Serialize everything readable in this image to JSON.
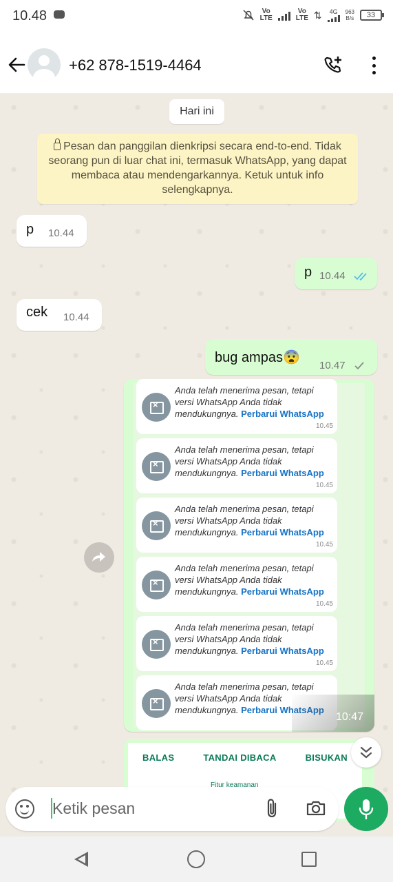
{
  "statusbar": {
    "time": "10.48",
    "volte1": "Vo\nLTE",
    "volte2": "Vo\nLTE",
    "net": "4G",
    "speed": "963\nB/s",
    "battery": "33"
  },
  "header": {
    "contact": "+62 878-1519-4464"
  },
  "chat": {
    "day_chip": "Hari ini",
    "encryption_notice": "Pesan dan panggilan dienkripsi secara end-to-end. Tidak seorang pun di luar chat ini, termasuk WhatsApp, yang dapat membaca atau mendengarkannya. Ketuk untuk info selengkapnya.",
    "messages": [
      {
        "dir": "in",
        "text": "p",
        "time": "10.44"
      },
      {
        "dir": "out",
        "text": "p",
        "time": "10.44",
        "status": "read"
      },
      {
        "dir": "in",
        "text": "cek",
        "time": "10.44"
      },
      {
        "dir": "out",
        "text": "bug ampas😨",
        "time": "10.47",
        "status": "sent"
      }
    ],
    "forwarded": {
      "time": "10:47",
      "cards": [
        {
          "msg": "Anda telah menerima pesan, tetapi versi WhatsApp Anda tidak mendukungnya.",
          "link": "Perbarui WhatsApp",
          "time": "10.45"
        },
        {
          "msg": "Anda telah menerima pesan, tetapi versi WhatsApp Anda tidak mendukungnya.",
          "link": "Perbarui WhatsApp",
          "time": "10.45"
        },
        {
          "msg": "Anda telah menerima pesan, tetapi versi WhatsApp Anda tidak mendukungnya.",
          "link": "Perbarui WhatsApp",
          "time": "10.45"
        },
        {
          "msg": "Anda telah menerima pesan, tetapi versi WhatsApp Anda tidak mendukungnya.",
          "link": "Perbarui WhatsApp",
          "time": "10.45"
        },
        {
          "msg": "Anda telah menerima pesan, tetapi versi WhatsApp Anda tidak mendukungnya.",
          "link": "Perbarui WhatsApp",
          "time": "10.45"
        },
        {
          "msg": "Anda telah menerima pesan, tetapi versi WhatsApp Anda tidak mendukungnya.",
          "link": "Perbarui WhatsApp",
          "time": ""
        }
      ]
    },
    "bottom_actions": [
      "BALAS",
      "TANDAI DIBACA",
      "BISUKAN"
    ],
    "bottom_hint": "Fitur keamanan"
  },
  "input": {
    "placeholder": "Ketik pesan"
  },
  "colors": {
    "outgoing": "#d9fdd3",
    "incoming": "#ffffff",
    "chat_bg": "#efeae2",
    "accent": "#1daa61",
    "link": "#1673c6"
  }
}
